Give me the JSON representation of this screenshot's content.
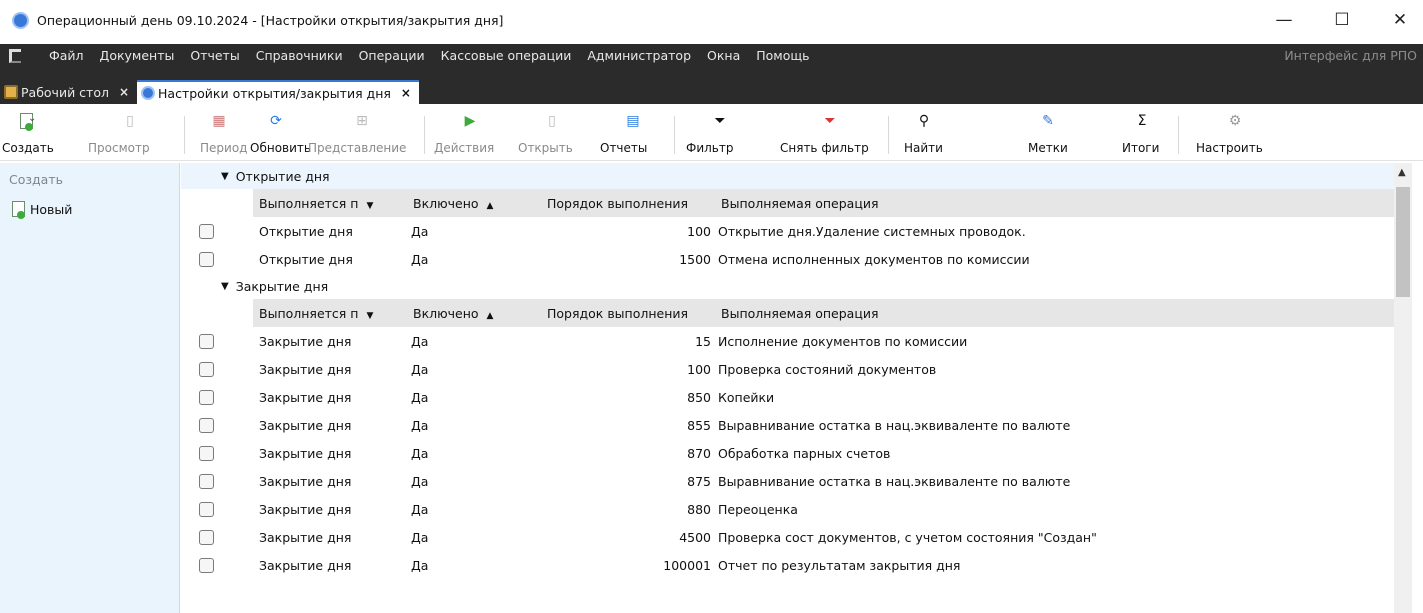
{
  "window": {
    "title": "Операционный день 09.10.2024 - [Настройки открытия/закрытия дня]",
    "minimize": "—",
    "maximize": "☐",
    "close": "✕"
  },
  "menu": {
    "items": [
      "Файл",
      "Документы",
      "Отчеты",
      "Справочники",
      "Операции",
      "Кассовые операции",
      "Администратор",
      "Окна",
      "Помощь"
    ],
    "right_text": "Интерфейс для РПО"
  },
  "tabs": [
    {
      "label": "Рабочий стол",
      "close": "×"
    },
    {
      "label": "Настройки открытия/закрытия дня",
      "close": "×"
    }
  ],
  "toolbar": {
    "create": "Создать",
    "view": "Просмотр",
    "period": "Период",
    "refresh": "Обновить",
    "presentation": "Представление",
    "actions": "Действия",
    "open": "Открыть",
    "reports": "Отчеты",
    "filter": "Фильтр",
    "clear_filter": "Снять фильтр",
    "find": "Найти",
    "marks": "Метки",
    "totals": "Итоги",
    "settings": "Настроить"
  },
  "left_panel": {
    "heading": "Создать",
    "new_item": "Новый"
  },
  "grid": {
    "columns": [
      "Выполняется п",
      "Включено",
      "Порядок выполнения",
      "Выполняемая операция"
    ],
    "groups": [
      {
        "title": "Открытие дня",
        "rows": [
          {
            "stage": "Открытие дня",
            "enabled": "Да",
            "order": "100",
            "operation": "Открытие дня.Удаление системных проводок."
          },
          {
            "stage": "Открытие дня",
            "enabled": "Да",
            "order": "1500",
            "operation": "Отмена исполненных документов по комиссии"
          }
        ]
      },
      {
        "title": "Закрытие дня",
        "rows": [
          {
            "stage": "Закрытие дня",
            "enabled": "Да",
            "order": "15",
            "operation": "Исполнение документов по комиссии"
          },
          {
            "stage": "Закрытие дня",
            "enabled": "Да",
            "order": "100",
            "operation": "Проверка состояний документов"
          },
          {
            "stage": "Закрытие дня",
            "enabled": "Да",
            "order": "850",
            "operation": "Копейки"
          },
          {
            "stage": "Закрытие дня",
            "enabled": "Да",
            "order": "855",
            "operation": "Выравнивание остатка в нац.эквиваленте по валюте"
          },
          {
            "stage": "Закрытие дня",
            "enabled": "Да",
            "order": "870",
            "operation": "Обработка парных счетов"
          },
          {
            "stage": "Закрытие дня",
            "enabled": "Да",
            "order": "875",
            "operation": "Выравнивание остатка в нац.эквиваленте по валюте"
          },
          {
            "stage": "Закрытие дня",
            "enabled": "Да",
            "order": "880",
            "operation": "Переоценка"
          },
          {
            "stage": "Закрытие дня",
            "enabled": "Да",
            "order": "4500",
            "operation": "Проверка сост документов, с учетом состояния \"Создан\""
          },
          {
            "stage": "Закрытие дня",
            "enabled": "Да",
            "order": "100001",
            "operation": "Отчет по результатам закрытия дня"
          }
        ]
      }
    ]
  },
  "colors": {
    "menubar": "#2b2b2b",
    "left_panel": "#eaf4fc",
    "group_highlight": "#ecf5fd",
    "header": "#e6e6e6"
  }
}
